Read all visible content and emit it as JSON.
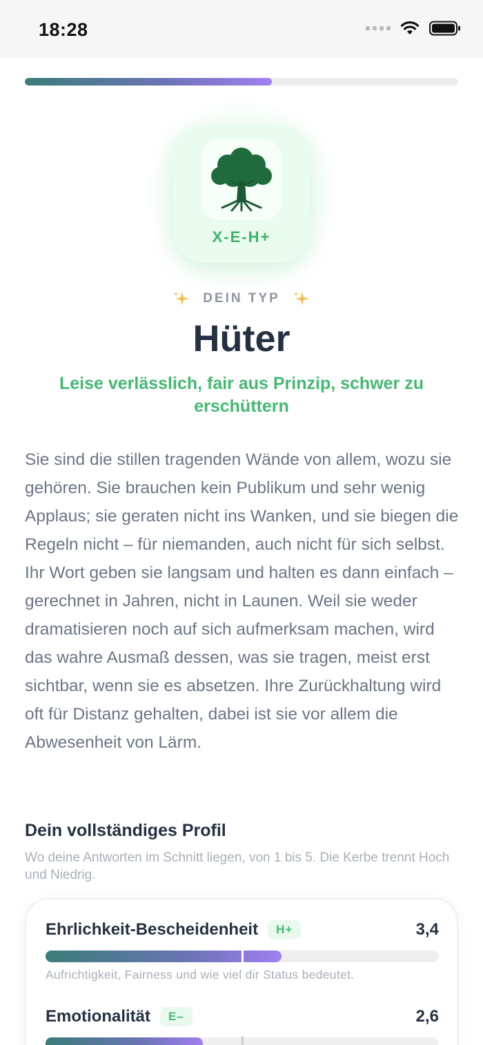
{
  "status_bar": {
    "time": "18:28"
  },
  "progress": {
    "fraction": 0.57
  },
  "type": {
    "code": "X-E-H+",
    "eyebrow": "DEIN TYP",
    "name": "Hüter",
    "tagline": "Leise verlässlich, fair aus Prinzip, schwer zu erschüttern",
    "description": "Sie sind die stillen tragenden Wände von allem, wozu sie gehören. Sie brauchen kein Publikum und sehr wenig Applaus; sie geraten nicht ins Wanken, und sie biegen die Regeln nicht – für niemanden, auch nicht für sich selbst. Ihr Wort geben sie langsam und halten es dann einfach – gerechnet in Jahren, nicht in Launen. Weil sie weder dramatisieren noch auf sich aufmerksam machen, wird das wahre Ausmaß dessen, was sie tragen, meist erst sichtbar, wenn sie es absetzen. Ihre Zurückhaltung wird oft für Distanz gehalten, dabei ist sie vor allem die Abwesenheit von Lärm."
  },
  "profile": {
    "title": "Dein vollständiges Profil",
    "subtitle": "Wo deine Antworten im Schnitt liegen, von 1 bis 5. Die Kerbe trennt Hoch und Niedrig.",
    "traits": [
      {
        "name": "Ehrlichkeit-Bescheidenheit",
        "badge": "H+",
        "score": "3,4",
        "value": 3.4,
        "description": "Aufrichtigkeit, Fairness und wie viel dir Status bedeutet."
      },
      {
        "name": "Emotionalität",
        "badge": "E–",
        "score": "2,6",
        "value": 2.6,
        "description": ""
      }
    ]
  },
  "colors": {
    "accent_green": "#45b872",
    "bar_start": "#3a7d78",
    "bar_end": "#a17ff0",
    "text_dark": "#253142"
  }
}
